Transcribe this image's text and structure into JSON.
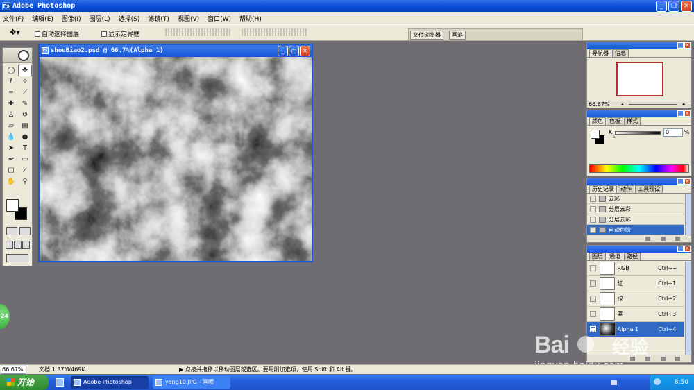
{
  "app": {
    "title": "Adobe Photoshop"
  },
  "menu": [
    "文件(F)",
    "编辑(E)",
    "图像(I)",
    "图层(L)",
    "选择(S)",
    "滤镜(T)",
    "视图(V)",
    "窗口(W)",
    "帮助(H)"
  ],
  "options": {
    "auto_select_label": "自动选择图层",
    "show_bounds_label": "显示定界框",
    "well_tabs": [
      "文件浏览器",
      "画笔"
    ]
  },
  "document": {
    "title": "shouBiao2.psd @ 66.7%(Alpha 1)"
  },
  "navigator": {
    "tabs": [
      "导航器",
      "信息"
    ],
    "zoom": "66.67%"
  },
  "color": {
    "tabs": [
      "颜色",
      "色板",
      "样式"
    ],
    "channel_label": "K",
    "value": "0",
    "unit": "%"
  },
  "history": {
    "tabs": [
      "历史记录",
      "动作",
      "工具预设"
    ],
    "items": [
      {
        "label": "云彩",
        "selected": false
      },
      {
        "label": "分层云彩",
        "selected": false
      },
      {
        "label": "分层云彩",
        "selected": false
      },
      {
        "label": "自动色阶",
        "selected": true
      }
    ]
  },
  "channels": {
    "tabs": [
      "图层",
      "通道",
      "路径"
    ],
    "items": [
      {
        "name": "RGB",
        "shortcut": "Ctrl+~",
        "selected": false
      },
      {
        "name": "红",
        "shortcut": "Ctrl+1",
        "selected": false
      },
      {
        "name": "绿",
        "shortcut": "Ctrl+2",
        "selected": false
      },
      {
        "name": "蓝",
        "shortcut": "Ctrl+3",
        "selected": false
      },
      {
        "name": "Alpha 1",
        "shortcut": "Ctrl+4",
        "selected": true
      }
    ]
  },
  "status": {
    "zoom": "66.67%",
    "doc": "文档:1.37M/469K",
    "hint": "▶ 点按并拖移以移动图层或选区。要用附加选项，使用 Shift 和 Alt 键。"
  },
  "taskbar": {
    "start": "开始",
    "tasks": [
      {
        "label": "Adobe Photoshop",
        "active": true
      },
      {
        "label": "yang10.JPG - 画图",
        "active": false
      }
    ],
    "clock": "8:50"
  },
  "watermark": {
    "brand": "Bai",
    "brand2": "经验",
    "url": "jingyan.baidu.com"
  },
  "side_badge": "24",
  "colors": {
    "xp_blue": "#1f57d2",
    "selection": "#316ac5",
    "workspace": "#6f6d72"
  }
}
